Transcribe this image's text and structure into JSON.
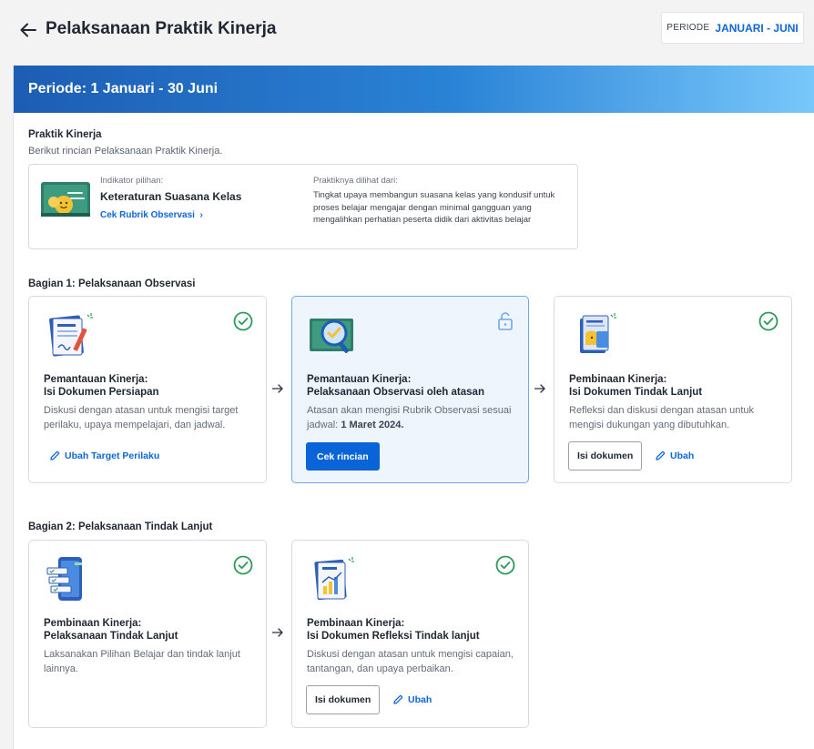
{
  "header": {
    "title": "Pelaksanaan Praktik Kinerja",
    "periode_label": "PERIODE",
    "periode_value": "JANUARI - JUNI"
  },
  "banner": {
    "text": "Periode: 1 Januari - 30 Juni"
  },
  "praktik": {
    "title": "Praktik Kinerja",
    "subtitle": "Berikut rincian Pelaksanaan Praktik Kinerja.",
    "indicator_caption": "Indikator pilihan:",
    "indicator_name": "Keteraturan Suasana Kelas",
    "rubrik_link": "Cek Rubrik Observasi",
    "seen_caption": "Praktiknya dilihat dari:",
    "seen_desc": "Tingkat upaya membangun suasana kelas yang kondusif untuk proses belajar mengajar dengan minimal gangguan yang mengalihkan perhatian peserta didik dari aktivitas belajar"
  },
  "bagian1": {
    "title": "Bagian 1: Pelaksanaan Observasi",
    "cards": [
      {
        "title": "Pemantauan Kinerja:\nIsi Dokumen Persiapan",
        "desc": "Diskusi dengan atasan untuk mengisi target perilaku, upaya mempelajari, dan jadwal.",
        "link": "Ubah Target Perilaku",
        "status_icon": "check-circle-icon"
      },
      {
        "title": "Pemantauan Kinerja:\nPelaksanaan Observasi oleh atasan",
        "desc": "Atasan akan mengisi Rubrik Observasi sesuai jadwal:",
        "desc_bold": "1 Maret 2024.",
        "button": "Cek rincian",
        "status_icon": "unlock-icon"
      },
      {
        "title": "Pembinaan Kinerja:\nIsi Dokumen Tindak Lanjut",
        "desc": "Refleksi dan diskusi dengan atasan untuk mengisi dukungan yang dibutuhkan.",
        "button": "Isi dokumen",
        "link": "Ubah",
        "status_icon": "check-circle-icon"
      }
    ]
  },
  "bagian2": {
    "title": "Bagian 2: Pelaksanaan Tindak Lanjut",
    "cards": [
      {
        "title": "Pembinaan Kinerja:\nPelaksanaan Tindak Lanjut",
        "desc": "Laksanakan Pilihan Belajar dan tindak lanjut lainnya.",
        "status_icon": "check-circle-icon"
      },
      {
        "title": "Pembinaan Kinerja:\nIsi Dokumen Refleksi Tindak lanjut",
        "desc": "Diskusi dengan atasan untuk mengisi capaian, tantangan, dan upaya perbaikan.",
        "button": "Isi dokumen",
        "link": "Ubah",
        "status_icon": "check-circle-icon"
      }
    ]
  },
  "colors": {
    "accent": "#0e66d8",
    "success": "#2e9a5a",
    "banner_start": "#1d5db4",
    "banner_end": "#79c8fb"
  }
}
